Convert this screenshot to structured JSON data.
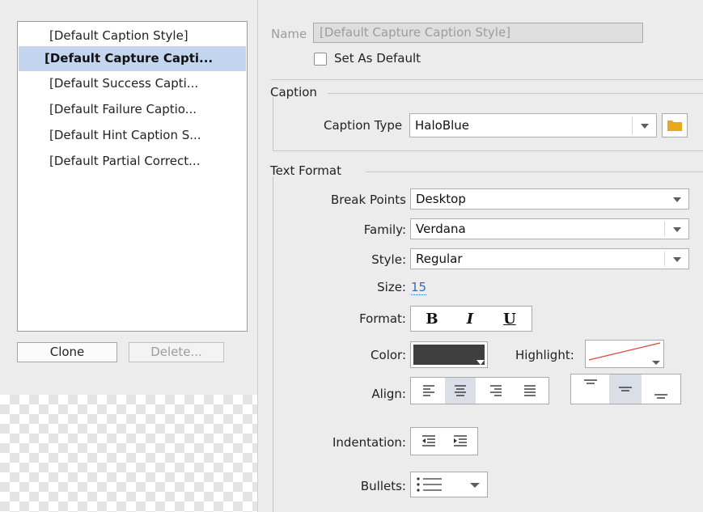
{
  "styles": {
    "items": [
      "[Default Caption Style]",
      "[Default Capture Capti...",
      "[Default Success Capti...",
      "[Default Failure Captio...",
      "[Default Hint Caption S...",
      "[Default Partial Correct..."
    ],
    "selected_index": 1,
    "clone_label": "Clone",
    "delete_label": "Delete..."
  },
  "name": {
    "label": "Name",
    "value": "[Default Capture Caption Style]",
    "set_default_label": "Set As Default",
    "set_default_checked": false
  },
  "caption": {
    "group_label": "Caption",
    "type_label": "Caption Type",
    "type_value": "HaloBlue"
  },
  "text_format": {
    "group_label": "Text Format",
    "break_points_label": "Break Points",
    "break_points_value": "Desktop",
    "family_label": "Family:",
    "family_value": "Verdana",
    "style_label": "Style:",
    "style_value": "Regular",
    "size_label": "Size:",
    "size_value": "15",
    "format_label": "Format:",
    "format_buttons": [
      "B",
      "I",
      "U"
    ],
    "color_label": "Color:",
    "color_value": "#3f3f3f",
    "highlight_label": "Highlight:",
    "align_label": "Align:",
    "align_selected": "center",
    "valign_selected": "middle",
    "indentation_label": "Indentation:",
    "bullets_label": "Bullets:"
  },
  "colors": {
    "selection": "#c4d6ef",
    "folder": "#e8a81c",
    "size_link": "#2a6fbf",
    "highlight_none_line": "#e0413a"
  }
}
